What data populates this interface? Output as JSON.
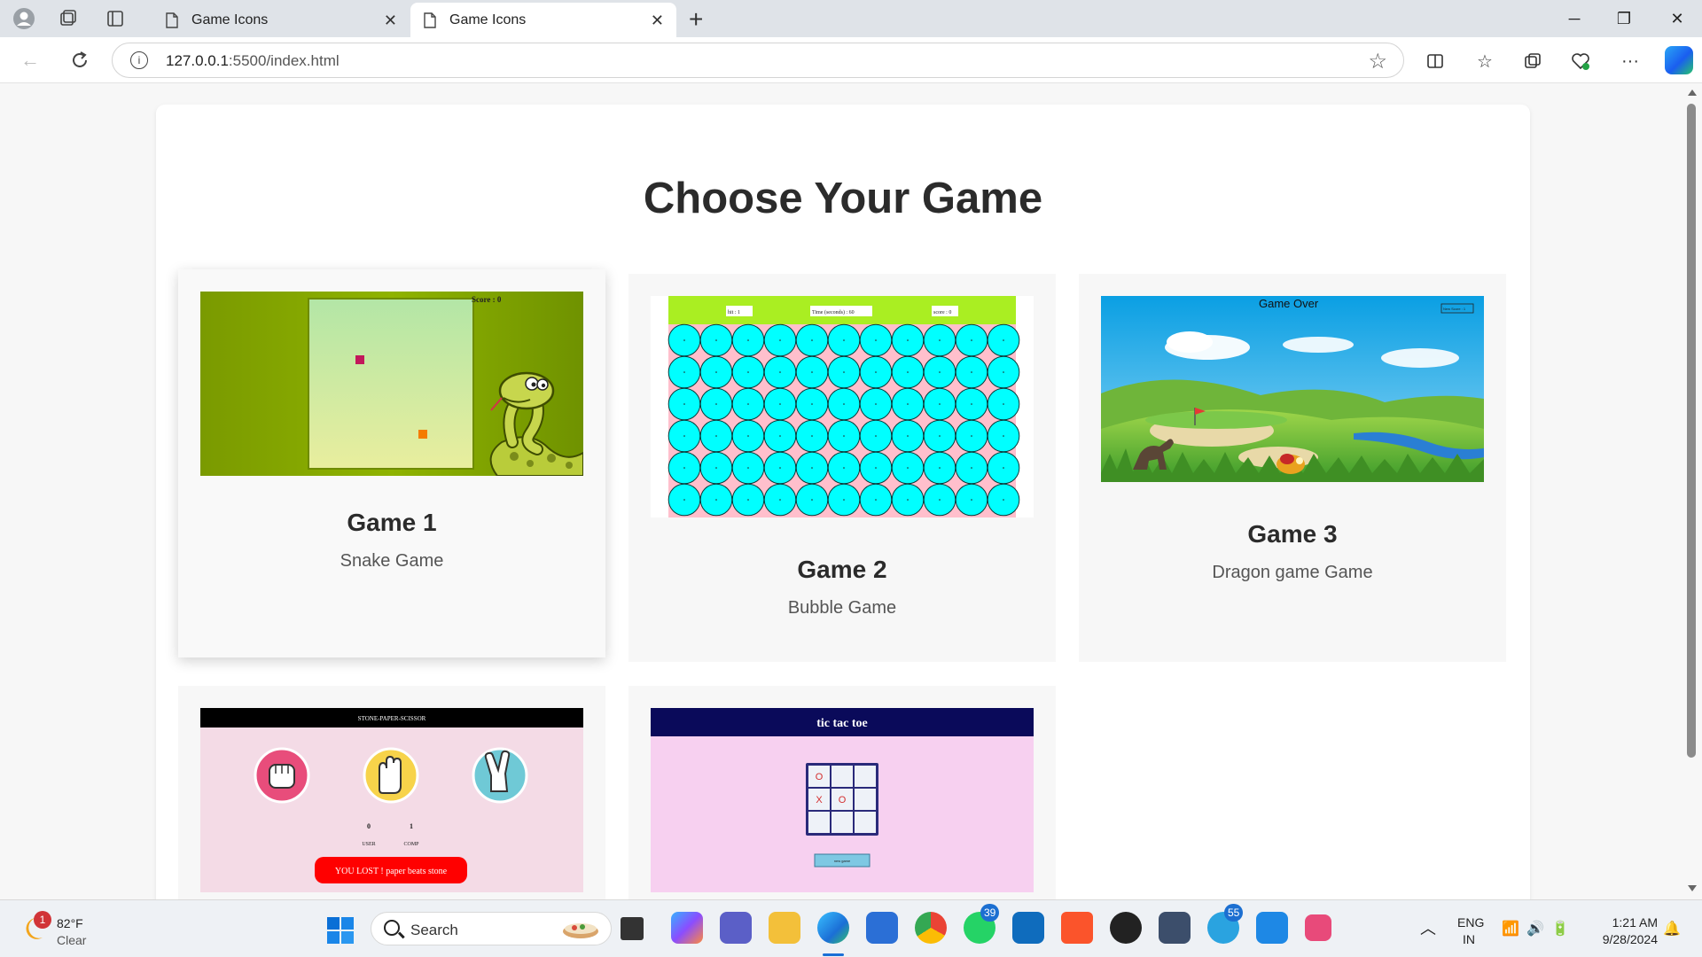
{
  "browser": {
    "tabs": [
      {
        "title": "Game Icons",
        "active": false
      },
      {
        "title": "Game Icons",
        "active": true
      }
    ],
    "address": {
      "host": "127.0.0.1",
      "path": ":5500/index.html"
    }
  },
  "page": {
    "title": "Choose Your Game",
    "games": [
      {
        "title": "Game 1",
        "description": "Snake Game"
      },
      {
        "title": "Game 2",
        "description": "Bubble Game"
      },
      {
        "title": "Game 3",
        "description": "Dragon game Game"
      },
      {
        "title": "",
        "description": ""
      },
      {
        "title": "",
        "description": ""
      }
    ],
    "thumbs": {
      "snake": {
        "score": "Score : 0"
      },
      "bubble": {
        "hit": "hit : 1",
        "timer": "Time (seconds) : 60",
        "score": "score : 0"
      },
      "dragon": {
        "status": "Game Over",
        "button": "New Score : 1"
      },
      "rps": {
        "header": "STONE-PAPER-SCISSOR",
        "user_score": "0",
        "comp_score": "1",
        "user_label": "USER",
        "comp_label": "COMP",
        "message": "YOU LOST ! paper beats stone"
      },
      "ttt": {
        "header": "tic tac toe",
        "cells": [
          "O",
          "",
          "",
          "X",
          "O",
          "",
          "",
          "",
          ""
        ],
        "button": "new game"
      }
    }
  },
  "taskbar": {
    "weather": {
      "temp": "82°F",
      "condition": "Clear",
      "alert": "1"
    },
    "search_label": "Search",
    "whatsapp_badge": "39",
    "telegram_badge": "55",
    "language": {
      "lang": "ENG",
      "region": "IN"
    },
    "clock": {
      "time": "1:21 AM",
      "date": "9/28/2024"
    }
  },
  "colors": {
    "bubble": "#00ffff",
    "page_bg": "#f7f7f7",
    "card_bg": "#f7f7f7",
    "rps_red": "#ff0000"
  }
}
